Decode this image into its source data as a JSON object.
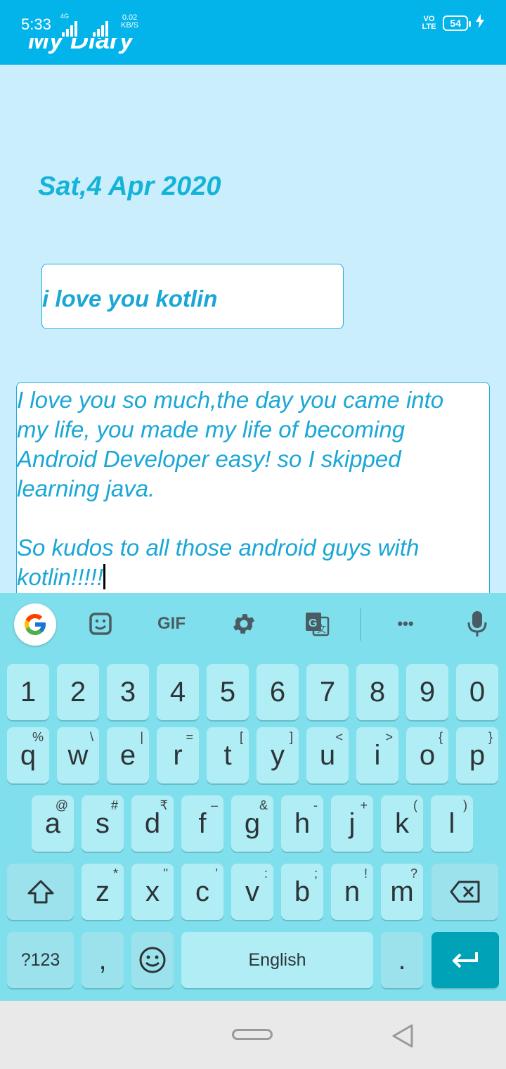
{
  "status": {
    "time": "5:33",
    "network": "4G",
    "speed_value": "0.02",
    "speed_unit": "KB/S",
    "volte_top": "VO",
    "volte_bottom": "LTE",
    "battery": "54"
  },
  "app": {
    "title": "My Diary"
  },
  "note": {
    "date": "Sat,4 Apr 2020",
    "title_value": "i love you kotlin",
    "body_value": "I love you so much,the day you came into my life, you made my life of becoming Android Developer easy! so I skipped learning java.\n\nSo kudos to all those android guys with kotlin!!!!!"
  },
  "keyboard": {
    "toolbar": {
      "gif_label": "GIF",
      "more_label": "•••"
    },
    "number_row": [
      "1",
      "2",
      "3",
      "4",
      "5",
      "6",
      "7",
      "8",
      "9",
      "0"
    ],
    "row1": [
      {
        "k": "q",
        "h": "%"
      },
      {
        "k": "w",
        "h": "\\"
      },
      {
        "k": "e",
        "h": "|"
      },
      {
        "k": "r",
        "h": "="
      },
      {
        "k": "t",
        "h": "["
      },
      {
        "k": "y",
        "h": "]"
      },
      {
        "k": "u",
        "h": "<"
      },
      {
        "k": "i",
        "h": ">"
      },
      {
        "k": "o",
        "h": "{"
      },
      {
        "k": "p",
        "h": "}"
      }
    ],
    "row2": [
      {
        "k": "a",
        "h": "@"
      },
      {
        "k": "s",
        "h": "#"
      },
      {
        "k": "d",
        "h": "₹"
      },
      {
        "k": "f",
        "h": "–"
      },
      {
        "k": "g",
        "h": "&"
      },
      {
        "k": "h",
        "h": "-"
      },
      {
        "k": "j",
        "h": "+"
      },
      {
        "k": "k",
        "h": "("
      },
      {
        "k": "l",
        "h": ")"
      }
    ],
    "row3": [
      {
        "k": "z",
        "h": "*"
      },
      {
        "k": "x",
        "h": "\""
      },
      {
        "k": "c",
        "h": "'"
      },
      {
        "k": "v",
        "h": ":"
      },
      {
        "k": "b",
        "h": ";"
      },
      {
        "k": "n",
        "h": "!"
      },
      {
        "k": "m",
        "h": "?"
      }
    ],
    "symbols_label": "?123",
    "comma": ",",
    "space_label": "English",
    "period": "."
  },
  "colors": {
    "accent": "#03b4ea",
    "keyboard_bg": "#80dfec",
    "key_bg": "#b1edf4",
    "enter_bg": "#00a2b8",
    "text_accent": "#1aa7d6"
  }
}
